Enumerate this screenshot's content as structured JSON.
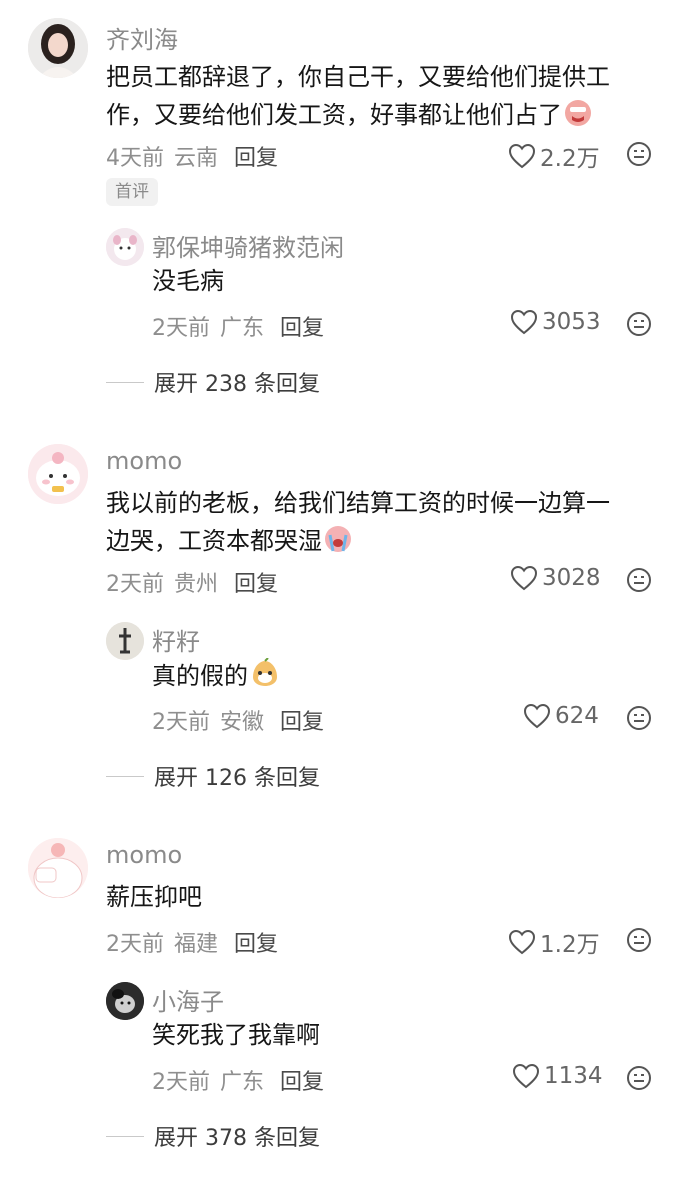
{
  "comments": [
    {
      "username": "齐刘海",
      "text": "把员工都辞退了，你自己干，又要给他们提供工作，又要给他们发工资，好事都让他们占了",
      "text_line1": "把员工都辞退了，你自己干，又要给他们提供工",
      "text_line2": "作，又要给他们发工资，好事都让他们占了",
      "emoji": "crying-face",
      "time": "4天前",
      "location": "云南",
      "reply_label": "回复",
      "likes": "2.2万",
      "badge": "首评",
      "reply": {
        "username": "郭保坤骑猪救范闲",
        "text": "没毛病",
        "time": "2天前",
        "location": "广东",
        "reply_label": "回复",
        "likes": "3053"
      },
      "expand_label": "展开 238 条回复"
    },
    {
      "username": "momo",
      "text_line1": "我以前的老板，给我们结算工资的时候一边算一",
      "text_line2": "边哭，工资本都哭湿",
      "emoji": "loudly-crying-face",
      "time": "2天前",
      "location": "贵州",
      "reply_label": "回复",
      "likes": "3028",
      "reply": {
        "username": "籽籽",
        "text": "真的假的",
        "emoji": "pear-face",
        "time": "2天前",
        "location": "安徽",
        "reply_label": "回复",
        "likes": "624"
      },
      "expand_label": "展开 126 条回复"
    },
    {
      "username": "momo",
      "text": "薪压抑吧",
      "time": "2天前",
      "location": "福建",
      "reply_label": "回复",
      "likes": "1.2万",
      "reply": {
        "username": "小海子",
        "text": "笑死我了我靠啊",
        "time": "2天前",
        "location": "广东",
        "reply_label": "回复",
        "likes": "1134"
      },
      "expand_label": "展开 378 条回复"
    }
  ],
  "icons": {
    "like": "heart-outline-icon",
    "dislike": "dislike-face-icon"
  },
  "colors": {
    "username": "#8a8a8a",
    "text": "#161616",
    "meta": "#8e8e8e",
    "reply": "#4a4a4a"
  }
}
